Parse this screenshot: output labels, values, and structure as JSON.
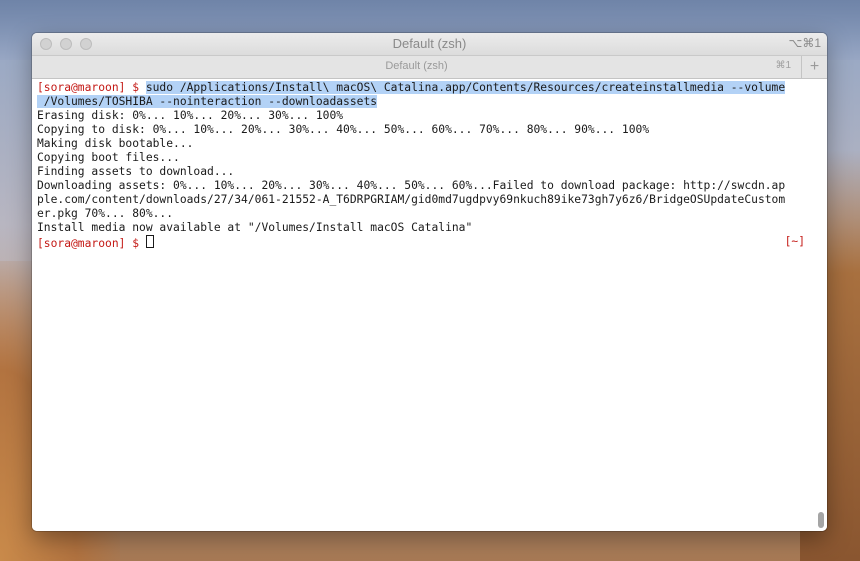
{
  "window": {
    "title": "Default (zsh)",
    "shortcut": "⌥⌘1"
  },
  "tab": {
    "label": "Default (zsh)",
    "shortcut": "⌘1",
    "new_tab_glyph": "+"
  },
  "terminal": {
    "prompt": "[sora@maroon] $ ",
    "command_line_1": "sudo /Applications/Install\\ macOS\\ Catalina.app/Contents/Resources/createinstallmedia --volume",
    "command_line_2": " /Volumes/TOSHIBA --nointeraction --downloadassets",
    "output_lines": [
      "Erasing disk: 0%... 10%... 20%... 30%... 100%",
      "Copying to disk: 0%... 10%... 20%... 30%... 40%... 50%... 60%... 70%... 80%... 90%... 100%",
      "Making disk bootable...",
      "Copying boot files...",
      "Finding assets to download...",
      "Downloading assets: 0%... 10%... 20%... 30%... 40%... 50%... 60%...Failed to download package: http://swcdn.ap",
      "ple.com/content/downloads/27/34/061-21552-A_T6DRPGRIAM/gid0md7ugdpvy69nkuch89ike73gh7y6z6/BridgeOSUpdateCustom",
      "er.pkg 70%... 80%...",
      "Install media now available at \"/Volumes/Install macOS Catalina\""
    ],
    "final_prompt": "[sora@maroon] $ ",
    "right_prompt": "[~]"
  },
  "colors": {
    "prompt": "#c41a16",
    "selection": "#b3d2f6"
  }
}
